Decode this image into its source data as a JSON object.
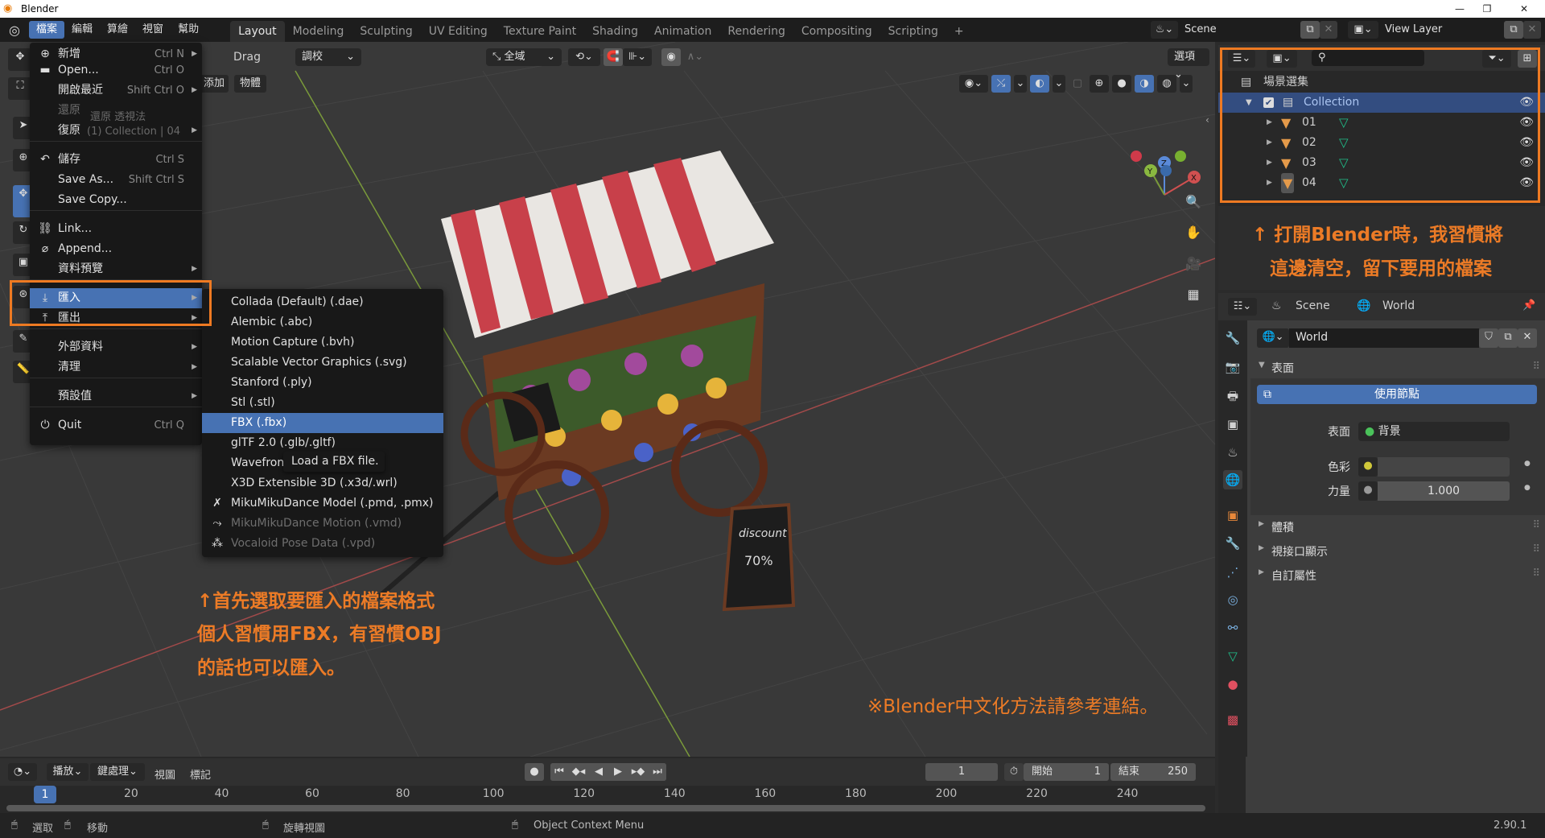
{
  "window": {
    "title": "Blender",
    "controls": [
      "minimize",
      "maximize",
      "close"
    ]
  },
  "topbar": {
    "menus": [
      "檔案",
      "編輯",
      "算繪",
      "視窗",
      "幫助"
    ],
    "workspaces": [
      "Layout",
      "Modeling",
      "Sculpting",
      "UV Editing",
      "Texture Paint",
      "Shading",
      "Animation",
      "Rendering",
      "Compositing",
      "Scripting",
      "+"
    ],
    "active_workspace": "Layout",
    "scene": "Scene",
    "view_layer": "View Layer"
  },
  "viewport_header": {
    "drag_label": "Drag",
    "drag_mode": "調校",
    "orientation": "全域",
    "options": "選項",
    "add": "添加",
    "object": "物體",
    "overlay_text": [
      "還原 透視法",
      "(1) Collection | 04"
    ]
  },
  "file_menu": {
    "items": [
      {
        "label": "新增",
        "shortcut": "Ctrl N",
        "submenu": true,
        "icon": "new-file-icon"
      },
      {
        "label": "Open...",
        "shortcut": "Ctrl O",
        "icon": "folder-icon"
      },
      {
        "label": "開啟最近",
        "shortcut": "Shift Ctrl O",
        "submenu": true
      },
      {
        "label": "還原",
        "disabled": true
      },
      {
        "label": "復原",
        "submenu": true
      },
      {
        "label": "儲存",
        "shortcut": "Ctrl S",
        "icon": "save-icon"
      },
      {
        "label": "Save As...",
        "shortcut": "Shift Ctrl S"
      },
      {
        "label": "Save Copy..."
      },
      {
        "label": "Link...",
        "icon": "link-icon"
      },
      {
        "label": "Append...",
        "icon": "append-icon"
      },
      {
        "label": "資料預覽",
        "submenu": true
      },
      {
        "label": "匯入",
        "submenu": true,
        "highlighted": true,
        "icon": "import-icon"
      },
      {
        "label": "匯出",
        "submenu": true,
        "icon": "export-icon"
      },
      {
        "label": "外部資料",
        "submenu": true
      },
      {
        "label": "清理",
        "submenu": true
      },
      {
        "label": "預設值",
        "submenu": true
      },
      {
        "label": "Quit",
        "shortcut": "Ctrl Q",
        "icon": "power-icon"
      }
    ]
  },
  "import_menu": {
    "items": [
      {
        "label": "Collada (Default) (.dae)"
      },
      {
        "label": "Alembic (.abc)"
      },
      {
        "label": "Motion Capture (.bvh)"
      },
      {
        "label": "Scalable Vector Graphics (.svg)"
      },
      {
        "label": "Stanford (.ply)"
      },
      {
        "label": "Stl (.stl)"
      },
      {
        "label": "FBX (.fbx)",
        "highlighted": true
      },
      {
        "label": "glTF 2.0 (.glb/.gltf)"
      },
      {
        "label": "Wavefront (.obj)"
      },
      {
        "label": "X3D Extensible 3D (.x3d/.wrl)"
      },
      {
        "label": "MikuMikuDance Model (.pmd, .pmx)",
        "icon": "mmd-model-icon"
      },
      {
        "label": "MikuMikuDance Motion (.vmd)",
        "disabled": true,
        "icon": "mmd-motion-icon"
      },
      {
        "label": "Vocaloid Pose Data (.vpd)",
        "disabled": true,
        "icon": "pose-icon"
      }
    ],
    "tooltip": "Load a FBX file."
  },
  "annotations": {
    "left": [
      "↑首先選取要匯入的檔案格式",
      "個人習慣用FBX，有習慣OBJ",
      "的話也可以匯入。"
    ],
    "right": [
      "↑ 打開Blender時，我習慣將",
      "這邊清空，留下要用的檔案"
    ],
    "bottom": "※Blender中文化方法請參考連結。",
    "color": "#ec7b26"
  },
  "outliner": {
    "root": "場景選集",
    "collection": "Collection",
    "objects": [
      "01",
      "02",
      "03",
      "04"
    ]
  },
  "properties": {
    "breadcrumb": [
      "Scene",
      "World"
    ],
    "world_name": "World",
    "panel_surface": "表面",
    "use_nodes": "使用節點",
    "surface_label": "表面",
    "surface_value": "背景",
    "color_label": "色彩",
    "strength_label": "力量",
    "strength_value": "1.000",
    "collapsed_panels": [
      "體積",
      "視接口顯示",
      "自訂屬性"
    ]
  },
  "timeline": {
    "menus": [
      "播放",
      "鍵處理",
      "視圖",
      "標記"
    ],
    "current_frame": "1",
    "start_label": "開始",
    "start": "1",
    "end_label": "結束",
    "end": "250",
    "ticks": [
      "20",
      "40",
      "60",
      "80",
      "100",
      "120",
      "140",
      "160",
      "180",
      "200",
      "220",
      "240"
    ],
    "playhead": "1"
  },
  "statusbar": {
    "items": [
      "選取",
      "移動",
      "旋轉視圖",
      "Object Context Menu"
    ],
    "version": "2.90.1"
  },
  "colors": {
    "accent": "#4772b3",
    "highlight_box": "#ee7a22",
    "mesh": "#e49a4a",
    "data": "#1fbf8a"
  }
}
